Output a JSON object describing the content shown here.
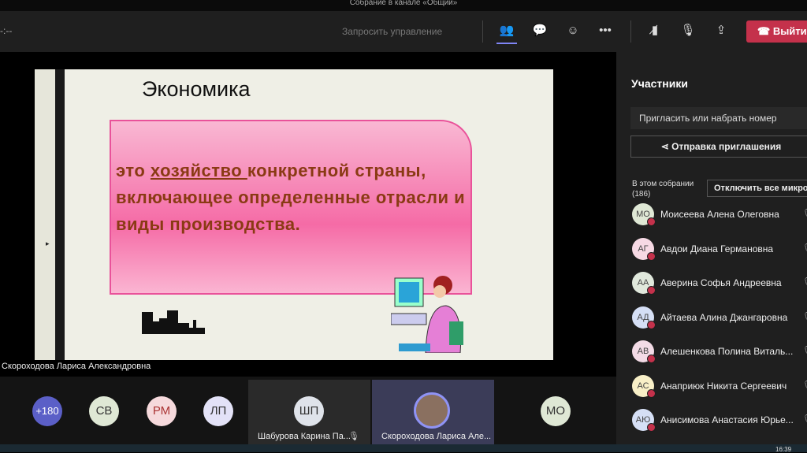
{
  "window": {
    "title": "Собрание в канале «Общий»"
  },
  "toolbar": {
    "left_text": "-:--",
    "request_control": "Запросить управление",
    "leave": "Выйти",
    "icons": [
      "people-icon",
      "chat-icon",
      "reactions-icon",
      "more-icon",
      "camera-off-icon",
      "mic-off-icon",
      "share-icon"
    ]
  },
  "slide": {
    "title": "Экономика",
    "text_pre": "это ",
    "text_underlined": "хозяйство ",
    "text_post": "конкретной страны, включающее определенные отрасли и виды производства."
  },
  "speaker_name": "Скороходова Лариса Александровна",
  "strip": {
    "tiles": [
      {
        "initials": "+180",
        "color": "#5b5fc7"
      },
      {
        "initials": "СВ",
        "color": "#dfe8d5"
      },
      {
        "initials": "РМ",
        "color": "#f6d9dc"
      },
      {
        "initials": "ЛП",
        "color": "#e3e2f7"
      }
    ],
    "named": [
      {
        "initials": "ШП",
        "name": "Шабурова Карина Па..."
      },
      {
        "name": "Скороходова Лариса Але..."
      }
    ],
    "last": "МО"
  },
  "panel": {
    "title": "Участники",
    "invite_placeholder": "Пригласить или набрать номер",
    "share_invite": "Отправка приглашения",
    "section": "В этом собрании",
    "count": "(186)",
    "mute_all": "Отключить все микро...",
    "participants": [
      {
        "initials": "МО",
        "name": "Моисеева Алена Олеговна",
        "color": "#dfe8d5"
      },
      {
        "initials": "АГ",
        "name": "Авдои Диана Германовна",
        "color": "#f6d9e4"
      },
      {
        "initials": "АА",
        "name": "Аверина Софья Андреевна",
        "color": "#e0e8dc"
      },
      {
        "initials": "АД",
        "name": "Айтаева Алина Джангаровна",
        "color": "#d5dff5"
      },
      {
        "initials": "АВ",
        "name": "Алешенкова Полина Виталь...",
        "color": "#f3dbe6"
      },
      {
        "initials": "АС",
        "name": "Анаприюк Никита Сергеевич",
        "color": "#f8efc7"
      },
      {
        "initials": "АЮ",
        "name": "Анисимова Анастасия Юрье...",
        "color": "#d5dff5"
      }
    ]
  },
  "clock": "16:39"
}
